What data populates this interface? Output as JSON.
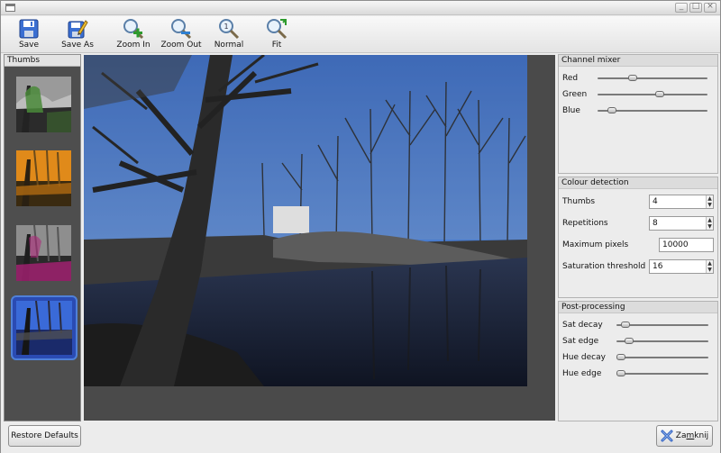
{
  "window": {
    "title": ""
  },
  "toolbar": {
    "save": {
      "label": "Save",
      "icon": "floppy-disk-icon"
    },
    "save_as": {
      "label": "Save As",
      "icon": "floppy-pencil-icon"
    },
    "zoom_in": {
      "label": "Zoom In",
      "icon": "magnifier-plus-icon"
    },
    "zoom_out": {
      "label": "Zoom Out",
      "icon": "magnifier-minus-icon"
    },
    "normal": {
      "label": "Normal",
      "icon": "magnifier-one-to-one-icon"
    },
    "fit": {
      "label": "Fit",
      "icon": "magnifier-fit-icon"
    }
  },
  "thumbs": {
    "title": "Thumbs",
    "items": [
      {
        "tint": "#4a8a3a",
        "selected": false
      },
      {
        "tint": "#e08a1a",
        "selected": false
      },
      {
        "tint": "#b0207a",
        "selected": false
      },
      {
        "tint": "#2c5bd8",
        "selected": true
      }
    ]
  },
  "channel_mixer": {
    "title": "Channel mixer",
    "red": {
      "label": "Red",
      "value": 0.3
    },
    "green": {
      "label": "Green",
      "value": 0.57
    },
    "blue": {
      "label": "Blue",
      "value": 0.1
    }
  },
  "colour_detection": {
    "title": "Colour detection",
    "thumbs": {
      "label": "Thumbs",
      "value": "4"
    },
    "repetitions": {
      "label": "Repetitions",
      "value": "8"
    },
    "maximum_pixels": {
      "label": "Maximum pixels",
      "value": "10000"
    },
    "saturation_threshold": {
      "label": "Saturation threshold",
      "value": "16"
    }
  },
  "post_processing": {
    "title": "Post-processing",
    "sat_decay": {
      "label": "Sat decay",
      "value": 0.05
    },
    "sat_edge": {
      "label": "Sat edge",
      "value": 0.1
    },
    "hue_decay": {
      "label": "Hue decay",
      "value": 0.0
    },
    "hue_edge": {
      "label": "Hue edge",
      "value": 0.0
    }
  },
  "footer": {
    "restore_defaults": "Restore Defaults",
    "close": "Zamknij",
    "close_mnemonic": "m"
  },
  "colors": {
    "selection": "#4f80d8",
    "sky": "#3a7ad8",
    "panel_dark": "#4e4e4e"
  }
}
